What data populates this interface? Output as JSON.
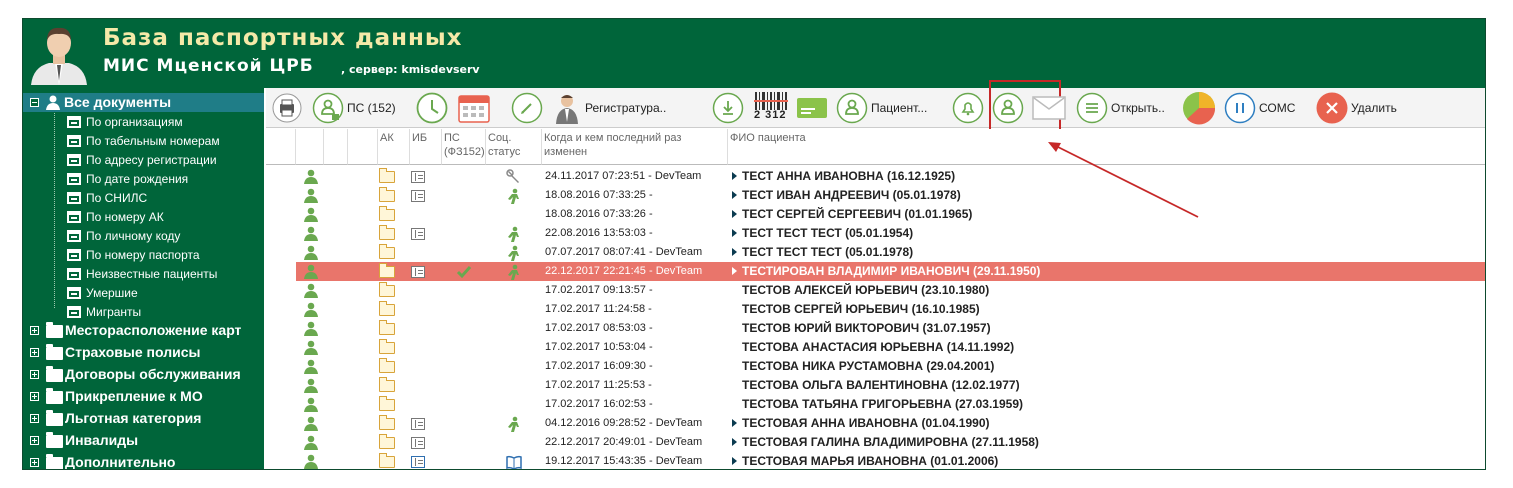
{
  "header": {
    "title": "База паспортных данных",
    "subtitle": "МИС Мценской ЦРБ",
    "server": ", сервер: kmisdevserv"
  },
  "sidebar": {
    "root_label": "Все документы",
    "sub_items": [
      "По организациям",
      "По табельным номерам",
      "По адресу регистрации",
      "По дате рождения",
      "По СНИЛС",
      "По номеру АК",
      "По личному коду",
      "По номеру паспорта",
      "Неизвестные пациенты",
      "Умершие",
      "Мигранты"
    ],
    "groups": [
      "Месторасположение карт",
      "Страховые полисы",
      "Договоры обслуживания",
      "Прикрепление к МО",
      "Льготная категория",
      "Инвалиды",
      "Дополнительно"
    ]
  },
  "toolbar": {
    "ps_label": "ПС (152)",
    "registry_label": "Регистратура..",
    "barcode_number": "2 312",
    "patient_label": "Пациент...",
    "open_label": "Открыть..",
    "soms_label": "СОМС",
    "delete_label": "Удалить"
  },
  "table": {
    "headers": {
      "ak": "АК",
      "ib": "ИБ",
      "ps": "ПС (ФЗ152)",
      "soc": "Соц. статус",
      "changed": "Когда и кем последний раз изменен",
      "fio": "ФИО пациента"
    },
    "rows": [
      {
        "changed": "24.11.2017 07:23:51 - DevTeam",
        "fio": "ТЕСТ АННА ИВАНОВНА (16.12.1925)",
        "ib": "gray",
        "soc": "wrench",
        "ps": "",
        "arrow": true,
        "selected": false
      },
      {
        "changed": "18.08.2016 07:33:25 -",
        "fio": "ТЕСТ ИВАН АНДРЕЕВИЧ (05.01.1978)",
        "ib": "gray",
        "soc": "person",
        "ps": "",
        "arrow": true,
        "selected": false
      },
      {
        "changed": "18.08.2016 07:33:26 -",
        "fio": "ТЕСТ СЕРГЕЙ СЕРГЕЕВИЧ (01.01.1965)",
        "ib": "",
        "soc": "",
        "ps": "",
        "arrow": true,
        "selected": false
      },
      {
        "changed": "22.08.2016 13:53:03 -",
        "fio": "ТЕСТ ТЕСТ ТЕСТ (05.01.1954)",
        "ib": "gray",
        "soc": "person",
        "ps": "",
        "arrow": true,
        "selected": false
      },
      {
        "changed": "07.07.2017 08:07:41 - DevTeam",
        "fio": "ТЕСТ ТЕСТ ТЕСТ (05.01.1978)",
        "ib": "",
        "soc": "person",
        "ps": "",
        "arrow": true,
        "selected": false
      },
      {
        "changed": "22.12.2017 22:21:45 - DevTeam",
        "fio": "ТЕСТИРОВАН ВЛАДИМИР ИВАНОВИЧ (29.11.1950)",
        "ib": "gray",
        "soc": "person",
        "ps": "check",
        "arrow": true,
        "selected": true
      },
      {
        "changed": "17.02.2017 09:13:57 -",
        "fio": "ТЕСТОВ АЛЕКСЕЙ ЮРЬЕВИЧ (23.10.1980)",
        "ib": "",
        "soc": "",
        "ps": "",
        "arrow": false,
        "selected": false
      },
      {
        "changed": "17.02.2017 11:24:58 -",
        "fio": "ТЕСТОВ СЕРГЕЙ ЮРЬЕВИЧ (16.10.1985)",
        "ib": "",
        "soc": "",
        "ps": "",
        "arrow": false,
        "selected": false
      },
      {
        "changed": "17.02.2017 08:53:03 -",
        "fio": "ТЕСТОВ ЮРИЙ ВИКТОРОВИЧ (31.07.1957)",
        "ib": "",
        "soc": "",
        "ps": "",
        "arrow": false,
        "selected": false
      },
      {
        "changed": "17.02.2017 10:53:04 -",
        "fio": "ТЕСТОВА АНАСТАСИЯ ЮРЬЕВНА (14.11.1992)",
        "ib": "",
        "soc": "",
        "ps": "",
        "arrow": false,
        "selected": false
      },
      {
        "changed": "17.02.2017 16:09:30 -",
        "fio": "ТЕСТОВА НИКА РУСТАМОВНА (29.04.2001)",
        "ib": "",
        "soc": "",
        "ps": "",
        "arrow": false,
        "selected": false
      },
      {
        "changed": "17.02.2017 11:25:53 -",
        "fio": "ТЕСТОВА ОЛЬГА ВАЛЕНТИНОВНА (12.02.1977)",
        "ib": "",
        "soc": "",
        "ps": "",
        "arrow": false,
        "selected": false
      },
      {
        "changed": "17.02.2017 16:02:53 -",
        "fio": "ТЕСТОВА ТАТЬЯНА ГРИГОРЬЕВНА (27.03.1959)",
        "ib": "",
        "soc": "",
        "ps": "",
        "arrow": false,
        "selected": false
      },
      {
        "changed": "04.12.2016 09:28:52 - DevTeam",
        "fio": "ТЕСТОВАЯ АННА ИВАНОВНА (01.04.1990)",
        "ib": "gray",
        "soc": "person",
        "ps": "",
        "arrow": true,
        "selected": false
      },
      {
        "changed": "22.12.2017 20:49:01 - DevTeam",
        "fio": "ТЕСТОВАЯ ГАЛИНА ВЛАДИМИРОВНА (27.11.1958)",
        "ib": "gray",
        "soc": "",
        "ps": "",
        "arrow": true,
        "selected": false
      },
      {
        "changed": "19.12.2017 15:43:35 - DevTeam",
        "fio": "ТЕСТОВАЯ МАРЬЯ ИВАНОВНА (01.01.2006)",
        "ib": "blue",
        "soc": "book",
        "ps": "",
        "arrow": true,
        "selected": false
      }
    ]
  },
  "colors": {
    "header_bg": "#00653a",
    "title_color": "#f5e9a8",
    "selected_row": "#e9756b",
    "tree_selected": "#1f7d87",
    "annotation": "#c62828"
  },
  "icons": [
    "printer-icon",
    "person-lock-icon",
    "clock-icon",
    "calendar-icon",
    "pencil-icon",
    "doctor-icon",
    "download-icon",
    "barcode-icon",
    "card-icon",
    "person-icon",
    "bell-icon",
    "person-icon",
    "mail-icon",
    "menu-icon",
    "pie-chart-icon",
    "pause-icon",
    "close-icon"
  ]
}
